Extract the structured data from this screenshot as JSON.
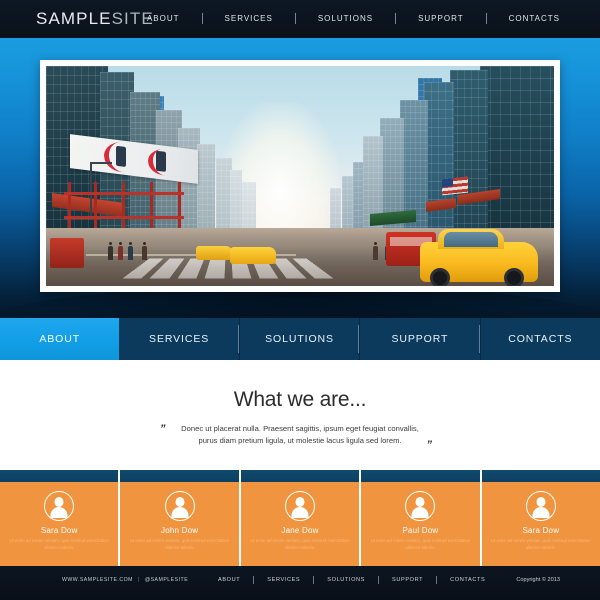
{
  "header": {
    "logo_primary": "SAMPLE",
    "logo_secondary": "SITE",
    "nav": [
      {
        "label": "ABOUT"
      },
      {
        "label": "SERVICES"
      },
      {
        "label": "SOLUTIONS"
      },
      {
        "label": "SUPPORT"
      },
      {
        "label": "CONTACTS"
      }
    ]
  },
  "hero": {
    "image_alt": "city-street-photo",
    "accent_color": "#1a9ce0",
    "frame_color": "#ffffff"
  },
  "main_nav": {
    "active_index": 0,
    "active_color": "#12a0e8",
    "inactive_color": "#0a3453",
    "tabs": [
      {
        "label": "ABOUT"
      },
      {
        "label": "SERVICES"
      },
      {
        "label": "SOLUTIONS"
      },
      {
        "label": "SUPPORT"
      },
      {
        "label": "CONTACTS"
      }
    ]
  },
  "about_section": {
    "title": "What we are...",
    "quote_open": "”",
    "quote_close": "”",
    "body": "Donec ut placerat nulla. Praesent sagittis, ipsum eget feugiat convallis, purus diam pretium ligula, ut molestie lacus ligula sed lorem."
  },
  "team": {
    "card_color": "#f0943f",
    "header_color": "#104a6b",
    "members": [
      {
        "name": "Sara Dow",
        "icon": "person-icon",
        "desc": "Ut enim ad minim veniam, quis nostrud exercitation ullamco laboris."
      },
      {
        "name": "John Dow",
        "icon": "person-icon",
        "desc": "Ut enim ad minim veniam, quis nostrud exercitation ullamco laboris."
      },
      {
        "name": "Jane Dow",
        "icon": "person-icon",
        "desc": "Ut enim ad minim veniam, quis nostrud exercitation ullamco laboris."
      },
      {
        "name": "Paul Dow",
        "icon": "person-icon",
        "desc": "Ut enim ad minim veniam, quis nostrud exercitation ullamco laboris."
      },
      {
        "name": "Sara Dow",
        "icon": "person-icon",
        "desc": "Ut enim ad minim veniam, quis nostrud exercitation ullamco laboris."
      }
    ]
  },
  "footer": {
    "website": "WWW.SAMPLESITE.COM",
    "separator": "|",
    "social": "@SAMPLESITE",
    "nav": [
      {
        "label": "ABOUT"
      },
      {
        "label": "SERVICES"
      },
      {
        "label": "SOLUTIONS"
      },
      {
        "label": "SUPPORT"
      },
      {
        "label": "CONTACTS"
      }
    ],
    "copyright": "Copyright © 2013"
  }
}
